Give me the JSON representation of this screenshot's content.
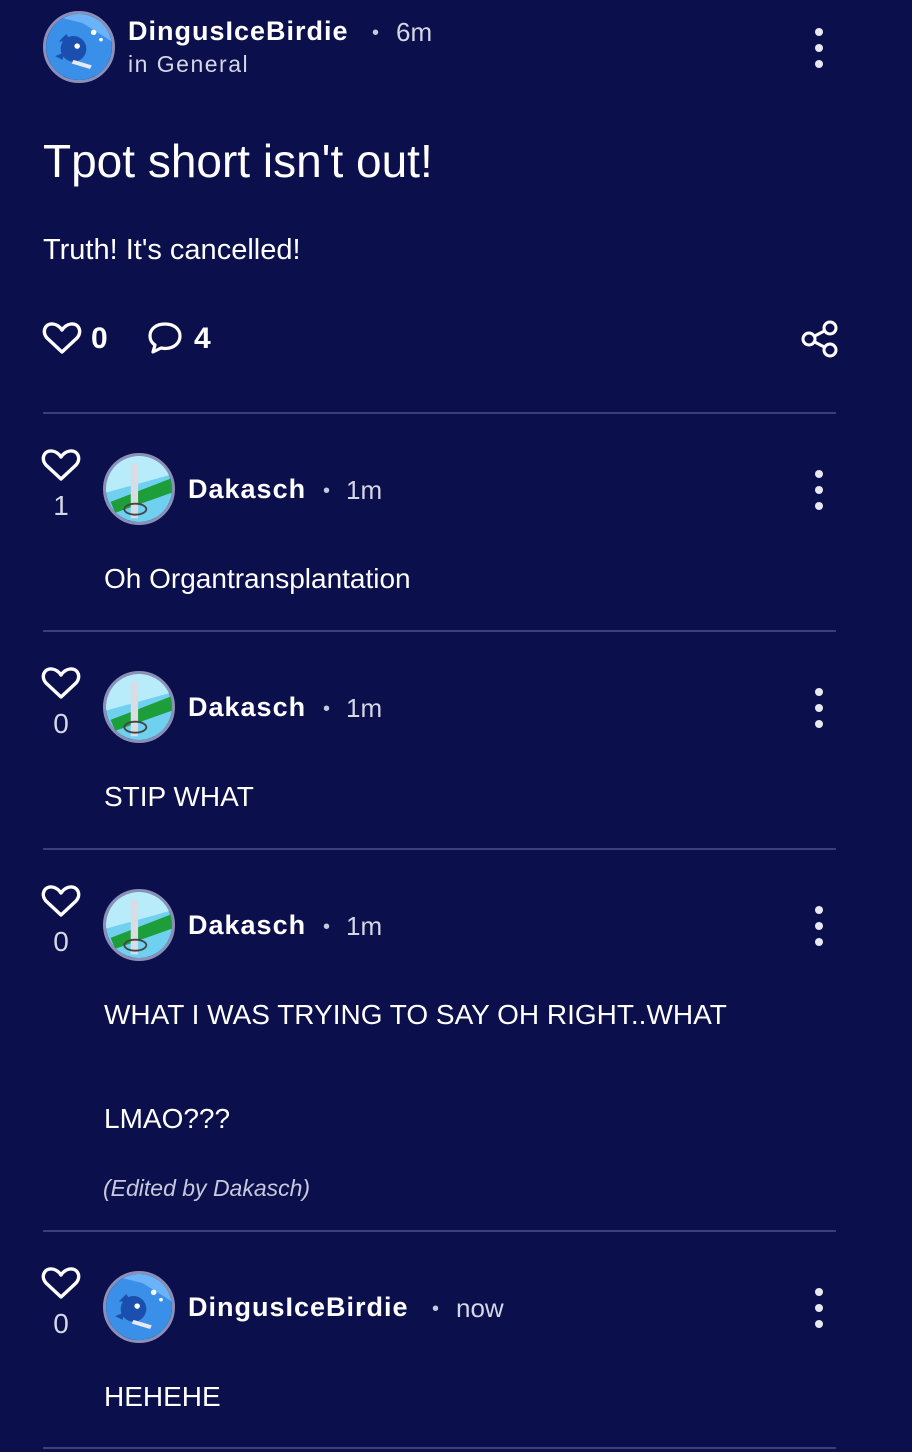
{
  "post": {
    "author": "DingusIceBirdie",
    "time": "6m",
    "category": "in General",
    "title": "Tpot short isn't out!",
    "body": "Truth! It's cancelled!",
    "likes": "0",
    "comments": "4",
    "author_avatar_icon": "blue-hedgehog-avatar"
  },
  "comments": [
    {
      "author": "Dakasch",
      "time": "1m",
      "likes": "1",
      "text": "Oh Organtransplantation",
      "avatar_icon": "green-bar-avatar"
    },
    {
      "author": "Dakasch",
      "time": "1m",
      "likes": "0",
      "text": "STIP WHAT",
      "avatar_icon": "green-bar-avatar"
    },
    {
      "author": "Dakasch",
      "time": "1m",
      "likes": "0",
      "text_line1": "WHAT I WAS TRYING TO SAY OH RIGHT..WHAT",
      "text_line2": "LMAO???",
      "edited": "(Edited by Dakasch)",
      "avatar_icon": "green-bar-avatar"
    },
    {
      "author": "DingusIceBirdie",
      "time": "now",
      "likes": "0",
      "text": "HEHEHE",
      "avatar_icon": "blue-hedgehog-avatar"
    }
  ],
  "colors": {
    "background": "#0b0f4b",
    "divider": "#3b3f7a",
    "text": "#ffffff",
    "muted": "#d5d6e6"
  }
}
